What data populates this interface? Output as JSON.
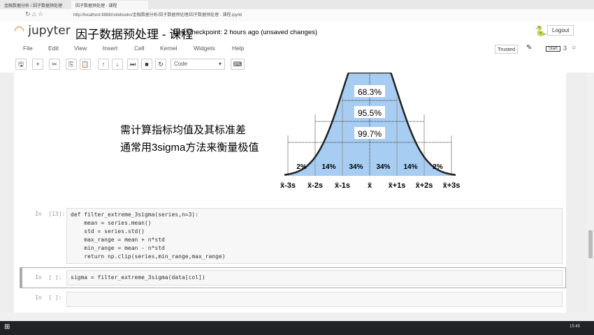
{
  "browser": {
    "tabs": [
      "金融数据分析 / 因子数据预处理",
      "因子数据预处理 - 课程"
    ],
    "url": "http://localhost:8888/notebooks/金融数据分析/因子数据预处理/因子数据预处理 - 课程.ipynb"
  },
  "header": {
    "logo": "jupyter",
    "title": "因子数据预处理 - 课程",
    "checkpoint": "Last Checkpoint: 2 hours ago (unsaved changes)",
    "logout": "Logout"
  },
  "menu": [
    "File",
    "Edit",
    "View",
    "Insert",
    "Cell",
    "Kernel",
    "Widgets",
    "Help"
  ],
  "kernel": {
    "trusted": "Trusted",
    "kernel_num": "3",
    "tooltip": "Start"
  },
  "toolbar": {
    "cell_type": "Code",
    "buttons": [
      "save-icon",
      "plus-icon",
      "cut-icon",
      "copy-icon",
      "paste-icon",
      "arrow-up-icon",
      "arrow-down-icon",
      "run-icon",
      "stop-icon",
      "restart-icon",
      "keyboard-icon"
    ]
  },
  "markdown": {
    "line1": "需计算指标均值及其标准差",
    "line2": "通常用3sigma方法来衡量极值"
  },
  "diagram": {
    "bands": [
      "68.3%",
      "95.5%",
      "99.7%"
    ],
    "segments": [
      "2%",
      "14%",
      "34%",
      "34%",
      "14%",
      "2%"
    ],
    "ticks": [
      "-3s",
      "-2s",
      "-1s",
      "",
      "+1s",
      "+2s",
      "+3s"
    ],
    "xbar": "x̄",
    "fill": "#a8cdf2"
  },
  "cells": [
    {
      "prompt": "In  [13]:",
      "lines": [
        "def filter_extreme_3sigma(series,n=3):",
        "    mean = series.mean()",
        "    std = series.std()",
        "    max_range = mean + n*std",
        "    min_range = mean - n*std",
        "    return np.clip(series,min_range,max_range)"
      ]
    },
    {
      "prompt": "In  [ ]:",
      "lines": [
        "sigma = filter_extreme_3sigma(data[col])"
      ]
    },
    {
      "prompt": "In  [ ]:",
      "lines": [
        ""
      ]
    }
  ],
  "clock": "15:45"
}
